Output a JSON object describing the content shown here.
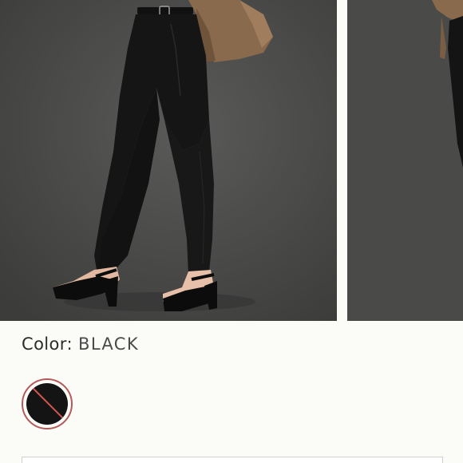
{
  "product": {
    "gallery": {
      "images": [
        {
          "icon": "model-wearing-black-skinny-jeans-photo"
        },
        {
          "icon": "model-next-photo-partial"
        }
      ],
      "background_color": "#4b4b4a"
    },
    "color": {
      "label": "Color:",
      "value": "BLACK"
    },
    "swatches": [
      {
        "name": "black",
        "color": "#141414",
        "unavailable": true,
        "ring_color": "#b45a5a"
      }
    ]
  }
}
